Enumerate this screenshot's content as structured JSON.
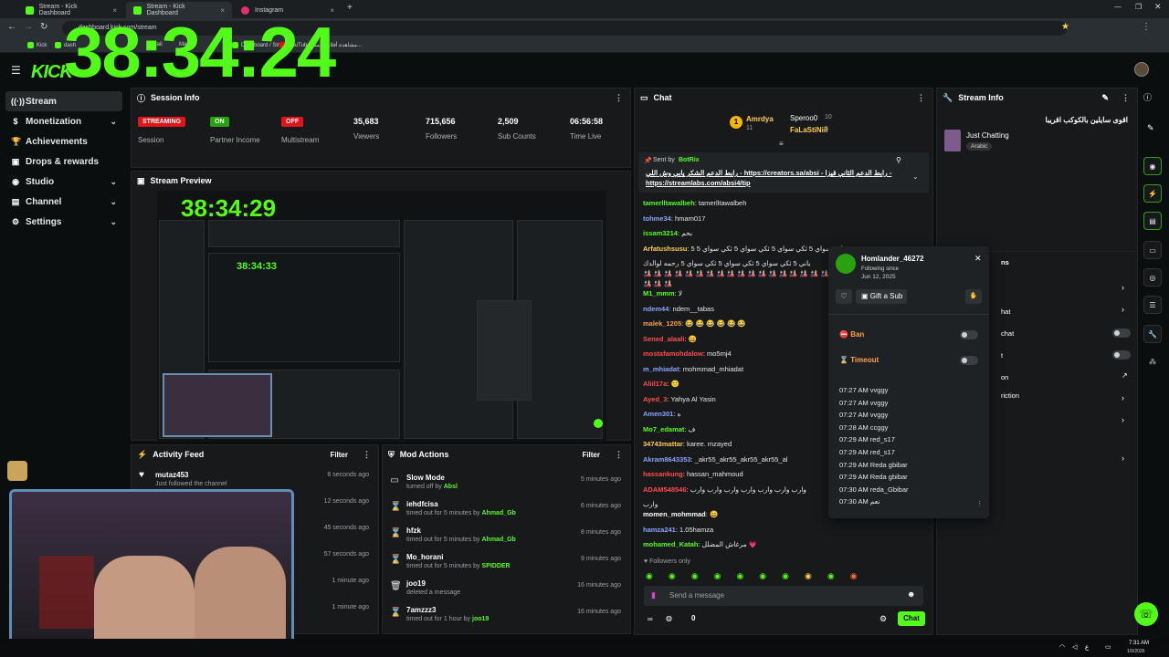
{
  "browser": {
    "tabs": [
      {
        "label": "Stream - Kick Dashboard"
      },
      {
        "label": "Stream - Kick Dashboard"
      },
      {
        "label": "Instagram"
      }
    ],
    "url": "dashboard.kick.com/stream",
    "bookmarks": [
      "Kick",
      "dash",
      "Gmail",
      "Maps",
      "Dashboard / Stream...",
      "YouTube",
      "مشاهدة أفلام ومسل..."
    ]
  },
  "overlay_timer": "38:34:24",
  "kick": {
    "logo": "KICK"
  },
  "sidebar": {
    "items": [
      {
        "label": "Stream",
        "icon": "broadcast-icon"
      },
      {
        "label": "Monetization",
        "icon": "dollar-icon"
      },
      {
        "label": "Achievements",
        "icon": "trophy-icon"
      },
      {
        "label": "Drops & rewards",
        "icon": "gift-icon"
      },
      {
        "label": "Studio",
        "icon": "studio-icon"
      },
      {
        "label": "Channel",
        "icon": "channel-icon"
      },
      {
        "label": "Settings",
        "icon": "gear-icon"
      }
    ]
  },
  "session_info": {
    "title": "Session Info",
    "stats": [
      {
        "badge": "STREAMING",
        "label": "Session"
      },
      {
        "badge": "ON",
        "label": "Partner Income"
      },
      {
        "badge": "OFF",
        "label": "Multistream"
      },
      {
        "value": "35,683",
        "label": "Viewers"
      },
      {
        "value": "715,656",
        "label": "Followers"
      },
      {
        "value": "2,509",
        "label": "Sub Counts"
      },
      {
        "value": "06:56:58",
        "label": "Time Live"
      }
    ]
  },
  "stream_preview": {
    "title": "Stream Preview",
    "timer": "38:34:29",
    "timer_nested": "38:34:33"
  },
  "activity_feed": {
    "title": "Activity Feed",
    "filter": "Filter",
    "rows": [
      {
        "name": "mutaz453",
        "sub": "Just followed the channel",
        "time": "6 seconds ago"
      },
      {
        "name": "",
        "sub": "",
        "time": "12 seconds ago"
      },
      {
        "name": "",
        "sub": "",
        "time": "45 seconds ago"
      },
      {
        "name": "",
        "sub": "",
        "time": "57 seconds ago"
      },
      {
        "name": "",
        "sub": "",
        "time": "1 minute ago"
      },
      {
        "name": "",
        "sub": "",
        "time": "1 minute ago"
      }
    ]
  },
  "mod_actions": {
    "title": "Mod Actions",
    "filter": "Filter",
    "rows": [
      {
        "name": "Slow Mode",
        "desc": "turned off by",
        "by": "Absl",
        "time": "5 minutes ago",
        "icon": "chat-icon"
      },
      {
        "name": "iehdfcisa",
        "desc": "timed out for 5 minutes by",
        "by": "Ahmad_Gb",
        "time": "6 minutes ago",
        "icon": "hourglass-icon"
      },
      {
        "name": "hfzk",
        "desc": "timed out for 5 minutes by",
        "by": "Ahmad_Gb",
        "time": "8 minutes ago",
        "icon": "hourglass-icon"
      },
      {
        "name": "Mo_horani",
        "desc": "timed out for 5 minutes by",
        "by": "SPIDDER",
        "time": "9 minutes ago",
        "icon": "hourglass-icon"
      },
      {
        "name": "joo19",
        "desc": "deleted a message",
        "by": "",
        "time": "16 minutes ago",
        "icon": "trash-icon"
      },
      {
        "name": "7amzzz3",
        "desc": "timed out for 1 hour by",
        "by": "joo19",
        "time": "16 minutes ago",
        "icon": "hourglass-icon"
      }
    ]
  },
  "chat": {
    "title": "Chat",
    "leaderboard": [
      {
        "name": "Amrdya",
        "count": "11"
      },
      {
        "name": "Speroo0",
        "count": "10"
      },
      {
        "name": "FaLaStiNiii",
        "count": "5"
      }
    ],
    "pinned": {
      "sent_by": "Sent by",
      "bot": "BotRix",
      "text": "رابط الدعم الشكر يابي وش اللي - https://creators.sa/absi - رابط الدعم الثاني قيزا - https://streamlabs.com/absi4/tip"
    },
    "messages": [
      {
        "user": "tamerlltawalbeh",
        "text": "tamerlltawalbeh",
        "color": "#53fc18"
      },
      {
        "user": "tohme34",
        "text": "hmam017",
        "color": "#8aa4ff"
      },
      {
        "user": "issam3214",
        "text": "بحم",
        "color": "#53fc18"
      },
      {
        "user": "Arfatushsusu",
        "text": "5 ثكي سواي 5 ثكي سواي 5 ثكي سواي 5 ثكي سواي 5",
        "color": "#ffcf4d"
      },
      {
        "user": "",
        "text": "ياني 5 ثكي سواي 5 ثكي سواي 5 ثكي سواي 5 رحمه لوالدك",
        "color": "#e6e8ea"
      },
      {
        "user": "",
        "text": "🎎 🎎 🎎 🎎 🎎 🎎 🎎 🎎 🎎 🎎 🎎 🎎 🎎 🎎 🎎 🎎 🎎 🎎 🎎 🎎 🎎",
        "color": "#e6e8ea"
      },
      {
        "user": "",
        "text": "🎎 🎎 🎎",
        "color": "#e6e8ea"
      },
      {
        "user": "M1_mmm",
        "text": "لا",
        "color": "#53fc18"
      },
      {
        "user": "ndem44",
        "text": "ndem__tabas",
        "color": "#8aa4ff"
      },
      {
        "user": "malek_1205",
        "text": "😂 😂 😂 😂 😂 😂",
        "color": "#ff9f43"
      },
      {
        "user": "Sened_alaali",
        "text": "😀",
        "color": "#ff4d4d"
      },
      {
        "user": "mostafamohdalow",
        "text": "mo5mj4",
        "color": "#ff4d4d"
      },
      {
        "user": "m_mhiadat",
        "text": "mohmmad_mhiadat",
        "color": "#8aa4ff"
      },
      {
        "user": "Aliil17a",
        "text": "🙂",
        "color": "#ff4d4d"
      },
      {
        "user": "Ayed_3",
        "text": "Yahya Al Yasin",
        "color": "#ff4d4d"
      },
      {
        "user": "Amen301",
        "text": "ه",
        "color": "#8aa4ff"
      },
      {
        "user": "Mo7_edamat",
        "text": "ف",
        "color": "#53fc18"
      },
      {
        "user": "34743mattar",
        "text": "karee. mzayed",
        "color": "#ffcf4d"
      },
      {
        "user": "Akram8643353",
        "text": "_akr55_akr55_akr55_akr55_al",
        "color": "#8aa4ff"
      },
      {
        "user": "hassankung",
        "text": "hassan_mahmoud",
        "color": "#ff4d4d"
      },
      {
        "user": "ADAM548546",
        "text": "وارب وارب وارب وارب وارب وارب وارب",
        "color": "#ff4d4d"
      },
      {
        "user": "",
        "text": "وارب",
        "color": "#e6e8ea"
      },
      {
        "user": "momen_mohmmad",
        "text": "😀",
        "color": "#ffffff"
      },
      {
        "user": "hamza241",
        "text": "1.05hamza",
        "color": "#8aa4ff"
      },
      {
        "user": "mohamed_Katah",
        "text": "مرغاش المضلل 💗",
        "color": "#53fc18"
      }
    ],
    "followers_only": "Followers only",
    "input_placeholder": "Send a message",
    "send_label": "Chat",
    "viewer_count": "0"
  },
  "user_card": {
    "username": "Homlander_46272",
    "following_since_label": "Following since",
    "following_since": "Jun 12, 2025",
    "gift_sub": "Gift a Sub",
    "ban": "Ban",
    "timeout": "Timeout",
    "log": [
      {
        "time": "07:27 AM",
        "msg": "vvggy"
      },
      {
        "time": "07:27 AM",
        "msg": "vvggy"
      },
      {
        "time": "07:27 AM",
        "msg": "vvggy"
      },
      {
        "time": "07:28 AM",
        "msg": "ccggy"
      },
      {
        "time": "07:29 AM",
        "msg": "red_s17"
      },
      {
        "time": "07:29 AM",
        "msg": "red_s17"
      },
      {
        "time": "07:29 AM",
        "msg": "Reda gbibar"
      },
      {
        "time": "07:29 AM",
        "msg": "Reda gbibar"
      },
      {
        "time": "07:30 AM",
        "msg": "reda_Gbibar"
      },
      {
        "time": "07:30 AM",
        "msg": "نعم"
      }
    ]
  },
  "stream_info": {
    "title": "Stream Info",
    "stream_title": "اقوى سايلين بالكوكب اقريبا",
    "category": "Just Chatting",
    "tag": "Arabic",
    "partial_labels": [
      "ns",
      "hat",
      "chat",
      "t",
      "on",
      "riction"
    ]
  },
  "taskbar": {
    "time": "7:31 AM",
    "date": "1/9/2026"
  },
  "colors": {
    "accent": "#53fc18",
    "streaming": "#e2141b",
    "panel": "#18191b"
  }
}
